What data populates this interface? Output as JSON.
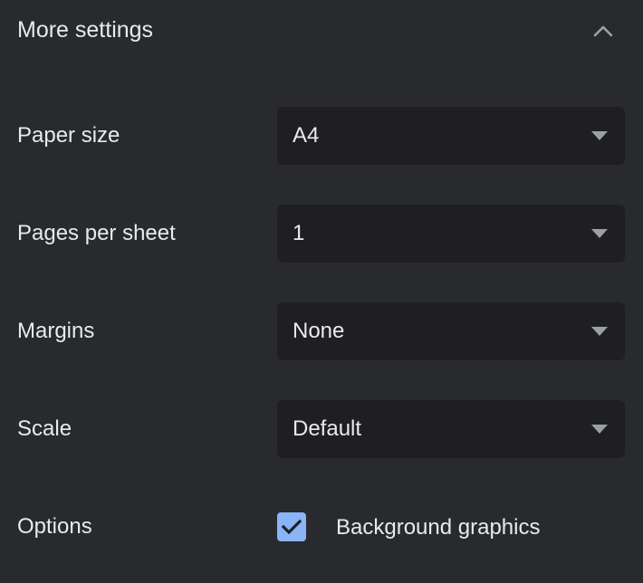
{
  "header": {
    "title": "More settings",
    "collapse_icon": "chevron-up-icon"
  },
  "settings": [
    {
      "label": "Paper size",
      "value": "A4"
    },
    {
      "label": "Pages per sheet",
      "value": "1"
    },
    {
      "label": "Margins",
      "value": "None"
    },
    {
      "label": "Scale",
      "value": "Default"
    }
  ],
  "options": {
    "label": "Options",
    "checkbox_label": "Background graphics",
    "checked": true
  },
  "colors": {
    "background": "#292a2d",
    "select_background": "#1f1f21",
    "text": "#e8eaed",
    "checkbox_accent": "#8ab4f8",
    "icon": "#9aa0a6"
  }
}
